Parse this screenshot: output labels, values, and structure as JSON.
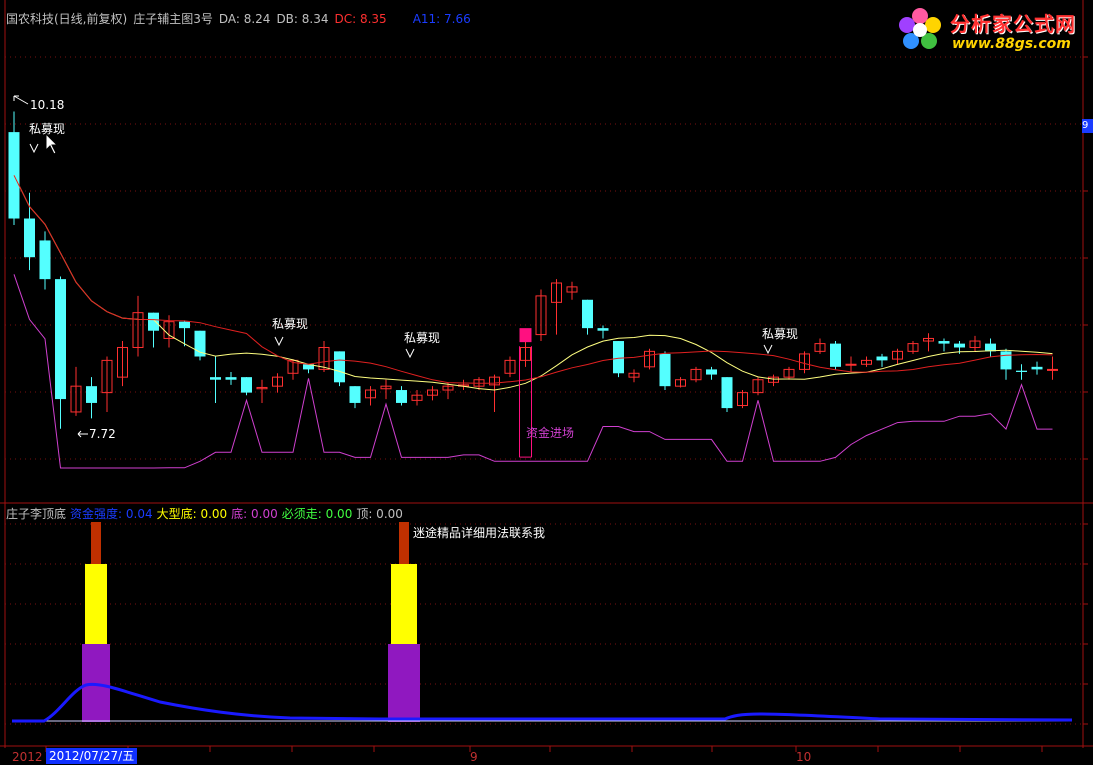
{
  "header": {
    "stock": "国农科技(日线,前复权)",
    "indicator": "庄子辅主图3号",
    "da_label": "DA: 8.24",
    "db_label": "DB: 8.34",
    "dc_label": "DC: 8.35",
    "a11_label": "A11: 7.66"
  },
  "main_annotations": {
    "high_label": "10.18",
    "low_label": "7.72",
    "signal_label": "私募现",
    "fund_entry_label": "资金进场"
  },
  "sub_header": {
    "indicator": "庄子李顶底",
    "strength": "资金强度: 0.04",
    "big_bottom": "大型底: 0.00",
    "bottom": "底: 0.00",
    "must_go": "必须走: 0.00",
    "top": "顶: 0.00",
    "promo_text": "迷途精品详细用法联系我"
  },
  "logo": {
    "title": "分析家公式网",
    "url": "www.88gs.com"
  },
  "xaxis": {
    "left_label": "2012",
    "date_box": "2012/07/27/五",
    "label_9": "9",
    "label_10": "10"
  },
  "right_tag": "9",
  "colors": {
    "up": "#ff3030",
    "down": "#54ffff",
    "ma_yellow": "#ffff80",
    "ma_red": "#e02020",
    "magenta": "#d040d0",
    "fund_bar": "#ff1080",
    "flow_line": "#1a1aff"
  },
  "chart_data": {
    "type": "candlestick",
    "candles": [
      {
        "o": 9.35,
        "c": 10.02,
        "h": 10.18,
        "l": 9.3,
        "dir": "down"
      },
      {
        "o": 9.35,
        "c": 9.05,
        "h": 9.55,
        "l": 8.95,
        "dir": "down"
      },
      {
        "o": 9.18,
        "c": 8.88,
        "h": 9.25,
        "l": 8.8,
        "dir": "down"
      },
      {
        "o": 8.88,
        "c": 7.95,
        "h": 8.9,
        "l": 7.72,
        "dir": "down"
      },
      {
        "o": 7.85,
        "c": 8.05,
        "h": 8.2,
        "l": 7.82,
        "dir": "up"
      },
      {
        "o": 7.92,
        "c": 8.05,
        "h": 8.12,
        "l": 7.8,
        "dir": "down"
      },
      {
        "o": 8.0,
        "c": 8.25,
        "h": 8.28,
        "l": 7.85,
        "dir": "up"
      },
      {
        "o": 8.12,
        "c": 8.35,
        "h": 8.4,
        "l": 8.05,
        "dir": "up"
      },
      {
        "o": 8.35,
        "c": 8.62,
        "h": 8.75,
        "l": 8.28,
        "dir": "up"
      },
      {
        "o": 8.62,
        "c": 8.48,
        "h": 8.62,
        "l": 8.35,
        "dir": "down"
      },
      {
        "o": 8.42,
        "c": 8.55,
        "h": 8.6,
        "l": 8.35,
        "dir": "up"
      },
      {
        "o": 8.55,
        "c": 8.5,
        "h": 8.56,
        "l": 8.36,
        "dir": "down"
      },
      {
        "o": 8.48,
        "c": 8.28,
        "h": 8.48,
        "l": 8.25,
        "dir": "down"
      },
      {
        "o": 8.12,
        "c": 8.1,
        "h": 8.28,
        "l": 7.92,
        "dir": "down"
      },
      {
        "o": 8.12,
        "c": 8.1,
        "h": 8.16,
        "l": 8.06,
        "dir": "down"
      },
      {
        "o": 8.12,
        "c": 8.0,
        "h": 8.12,
        "l": 7.98,
        "dir": "down"
      },
      {
        "o": 8.03,
        "c": 8.04,
        "h": 8.1,
        "l": 7.92,
        "dir": "up"
      },
      {
        "o": 8.05,
        "c": 8.12,
        "h": 8.15,
        "l": 8.0,
        "dir": "up"
      },
      {
        "o": 8.15,
        "c": 8.25,
        "h": 8.26,
        "l": 8.1,
        "dir": "up"
      },
      {
        "o": 8.22,
        "c": 8.18,
        "h": 8.22,
        "l": 8.15,
        "dir": "down"
      },
      {
        "o": 8.18,
        "c": 8.35,
        "h": 8.4,
        "l": 8.16,
        "dir": "up"
      },
      {
        "o": 8.32,
        "c": 8.08,
        "h": 8.32,
        "l": 8.05,
        "dir": "down"
      },
      {
        "o": 8.05,
        "c": 7.92,
        "h": 8.05,
        "l": 7.88,
        "dir": "down"
      },
      {
        "o": 7.96,
        "c": 8.02,
        "h": 8.05,
        "l": 7.9,
        "dir": "up"
      },
      {
        "o": 8.03,
        "c": 8.05,
        "h": 8.1,
        "l": 7.95,
        "dir": "up"
      },
      {
        "o": 8.02,
        "c": 7.92,
        "h": 8.05,
        "l": 7.9,
        "dir": "down"
      },
      {
        "o": 7.94,
        "c": 7.98,
        "h": 8.02,
        "l": 7.9,
        "dir": "up"
      },
      {
        "o": 7.98,
        "c": 8.02,
        "h": 8.05,
        "l": 7.94,
        "dir": "up"
      },
      {
        "o": 8.02,
        "c": 8.05,
        "h": 8.08,
        "l": 7.95,
        "dir": "up"
      },
      {
        "o": 8.05,
        "c": 8.06,
        "h": 8.1,
        "l": 8.02,
        "dir": "up"
      },
      {
        "o": 8.05,
        "c": 8.1,
        "h": 8.12,
        "l": 8.02,
        "dir": "up"
      },
      {
        "o": 8.06,
        "c": 8.12,
        "h": 8.14,
        "l": 7.85,
        "dir": "up"
      },
      {
        "o": 8.15,
        "c": 8.25,
        "h": 8.28,
        "l": 8.12,
        "dir": "up"
      },
      {
        "o": 8.25,
        "c": 8.35,
        "h": 8.4,
        "l": 8.2,
        "dir": "up"
      },
      {
        "o": 8.45,
        "c": 8.75,
        "h": 8.8,
        "l": 8.4,
        "dir": "up"
      },
      {
        "o": 8.7,
        "c": 8.85,
        "h": 8.88,
        "l": 8.45,
        "dir": "up"
      },
      {
        "o": 8.78,
        "c": 8.82,
        "h": 8.86,
        "l": 8.72,
        "dir": "up"
      },
      {
        "o": 8.72,
        "c": 8.5,
        "h": 8.72,
        "l": 8.45,
        "dir": "down"
      },
      {
        "o": 8.5,
        "c": 8.48,
        "h": 8.52,
        "l": 8.42,
        "dir": "down"
      },
      {
        "o": 8.4,
        "c": 8.15,
        "h": 8.4,
        "l": 8.12,
        "dir": "down"
      },
      {
        "o": 8.15,
        "c": 8.12,
        "h": 8.18,
        "l": 8.08,
        "dir": "up"
      },
      {
        "o": 8.2,
        "c": 8.32,
        "h": 8.34,
        "l": 8.18,
        "dir": "up"
      },
      {
        "o": 8.3,
        "c": 8.05,
        "h": 8.32,
        "l": 8.02,
        "dir": "down"
      },
      {
        "o": 8.05,
        "c": 8.1,
        "h": 8.12,
        "l": 8.04,
        "dir": "up"
      },
      {
        "o": 8.1,
        "c": 8.18,
        "h": 8.2,
        "l": 8.08,
        "dir": "up"
      },
      {
        "o": 8.18,
        "c": 8.14,
        "h": 8.2,
        "l": 8.1,
        "dir": "down"
      },
      {
        "o": 8.12,
        "c": 7.88,
        "h": 8.12,
        "l": 7.85,
        "dir": "down"
      },
      {
        "o": 7.9,
        "c": 8.0,
        "h": 8.02,
        "l": 7.88,
        "dir": "up"
      },
      {
        "o": 8.0,
        "c": 8.1,
        "h": 8.12,
        "l": 7.98,
        "dir": "up"
      },
      {
        "o": 8.08,
        "c": 8.12,
        "h": 8.14,
        "l": 8.05,
        "dir": "up"
      },
      {
        "o": 8.12,
        "c": 8.18,
        "h": 8.2,
        "l": 8.1,
        "dir": "up"
      },
      {
        "o": 8.18,
        "c": 8.3,
        "h": 8.32,
        "l": 8.15,
        "dir": "up"
      },
      {
        "o": 8.32,
        "c": 8.38,
        "h": 8.42,
        "l": 8.3,
        "dir": "up"
      },
      {
        "o": 8.38,
        "c": 8.2,
        "h": 8.4,
        "l": 8.18,
        "dir": "down"
      },
      {
        "o": 8.22,
        "c": 8.22,
        "h": 8.28,
        "l": 8.16,
        "dir": "up"
      },
      {
        "o": 8.22,
        "c": 8.25,
        "h": 8.28,
        "l": 8.2,
        "dir": "up"
      },
      {
        "o": 8.25,
        "c": 8.28,
        "h": 8.3,
        "l": 8.2,
        "dir": "down"
      },
      {
        "o": 8.26,
        "c": 8.32,
        "h": 8.34,
        "l": 8.22,
        "dir": "up"
      },
      {
        "o": 8.32,
        "c": 8.38,
        "h": 8.4,
        "l": 8.3,
        "dir": "up"
      },
      {
        "o": 8.4,
        "c": 8.42,
        "h": 8.46,
        "l": 8.32,
        "dir": "up"
      },
      {
        "o": 8.4,
        "c": 8.38,
        "h": 8.42,
        "l": 8.32,
        "dir": "down"
      },
      {
        "o": 8.38,
        "c": 8.35,
        "h": 8.4,
        "l": 8.3,
        "dir": "down"
      },
      {
        "o": 8.35,
        "c": 8.4,
        "h": 8.44,
        "l": 8.32,
        "dir": "up"
      },
      {
        "o": 8.38,
        "c": 8.32,
        "h": 8.42,
        "l": 8.28,
        "dir": "down"
      },
      {
        "o": 8.32,
        "c": 8.18,
        "h": 8.34,
        "l": 8.1,
        "dir": "down"
      },
      {
        "o": 8.16,
        "c": 8.17,
        "h": 8.22,
        "l": 8.1,
        "dir": "down"
      },
      {
        "o": 8.18,
        "c": 8.2,
        "h": 8.24,
        "l": 8.14,
        "dir": "down"
      },
      {
        "o": 8.18,
        "c": 8.18,
        "h": 8.28,
        "l": 8.1,
        "dir": "up"
      }
    ]
  }
}
